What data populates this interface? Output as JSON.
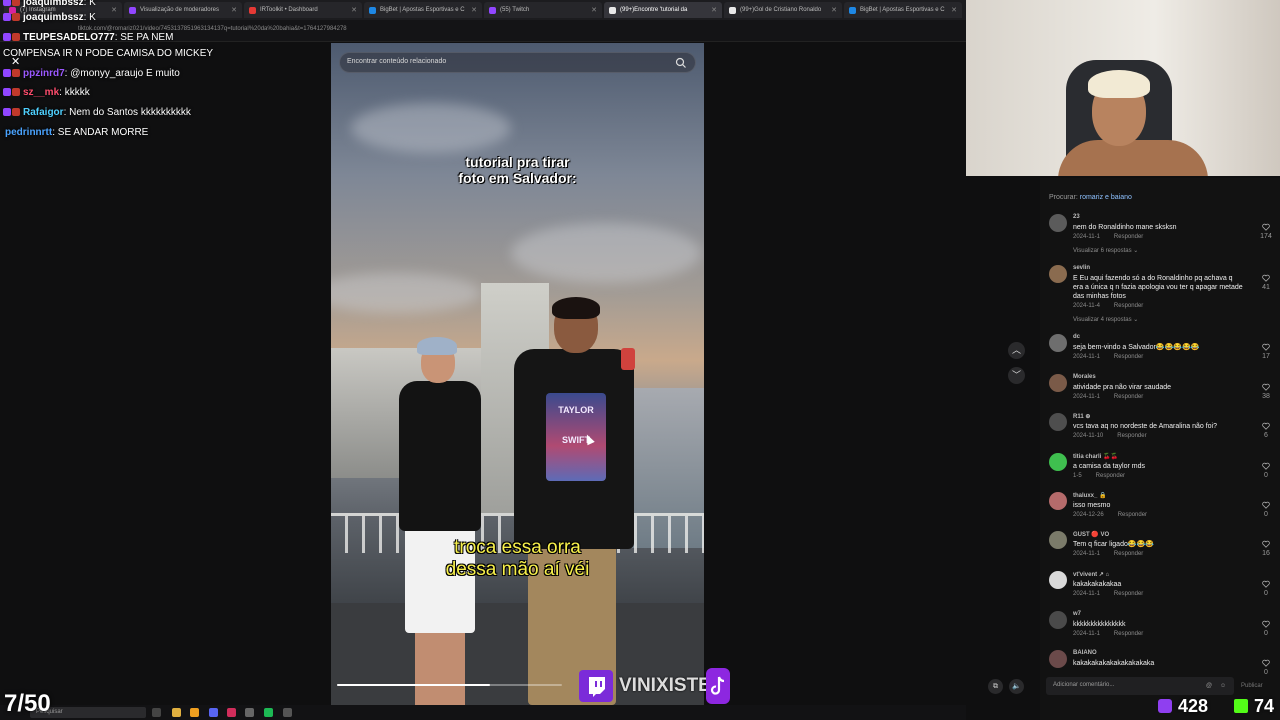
{
  "browser": {
    "tabs": [
      {
        "label": "(7) Instagram",
        "color": "#d6249f"
      },
      {
        "label": "Visualização de moderadores",
        "color": "#9146ff"
      },
      {
        "label": "IRToolkit • Dashboard",
        "color": "#e53935"
      },
      {
        "label": "BigBet | Apostas Esportivas e C",
        "color": "#1e88e5"
      },
      {
        "label": "(55) Twitch",
        "color": "#9146ff"
      },
      {
        "label": "(99+)Encontre 'tutorial da",
        "color": "#e8e8e8"
      },
      {
        "label": "(99+)Gol de Cristiano Ronaldo",
        "color": "#e8e8e8"
      },
      {
        "label": "BigBet | Apostas Esportivas e C",
        "color": "#1e88e5"
      }
    ],
    "url": "tiktok.com/@romariz021/video/7453137851963134137q=tutorial%20da%20bahia&t=1764127984278"
  },
  "chat": {
    "messages": [
      {
        "user": "joaquimbssz",
        "text": ": K",
        "user_color": "#ffffff"
      },
      {
        "user": "joaquimbssz",
        "text": ": K",
        "user_color": "#ffffff"
      },
      {
        "user": "TEUPESADELO777",
        "text": ": SE PA NEM",
        "user_color": "#ffffff"
      },
      {
        "user": "",
        "text": "COMPENSA IR N PODE CAMISA DO MICKEY",
        "user_color": "#ffffff"
      },
      {
        "user": "ppzinrd7",
        "text": ": @monyy_araujo E muito",
        "user_color": "#9b59ff"
      },
      {
        "user": "sz__mk",
        "text": ": kkkkk",
        "user_color": "#ff4d6d"
      },
      {
        "user": "Rafaigor",
        "text": ": Nem do Santos kkkkkkkkkk",
        "user_color": "#4fd1ff"
      },
      {
        "user": "pedrinnrtt",
        "text": ": SE ANDAR MORRE",
        "user_color": "#4aa3ff"
      }
    ]
  },
  "video": {
    "search_placeholder": "Encontrar conteúdo relacionado",
    "caption_top_line1": "tutorial pra tirar",
    "caption_top_line2": "foto em Salvador:",
    "caption_bottom_line1": "troca essa orra",
    "caption_bottom_line2": "dessa mão aí véi",
    "shirt_line1": "TAYLOR",
    "shirt_line2": "SWIFT",
    "progress_fraction": 0.68
  },
  "watermark": {
    "text": "VINIXISTE"
  },
  "comments_panel": {
    "search_label": "Procurar:",
    "search_query": "romariz e baiano",
    "comments": [
      {
        "user": "23",
        "text": "nem do Ronaldinho mane sksksn",
        "date": "2024-11-1",
        "reply": "Responder",
        "likes": "174",
        "more": "Visualizar 6 respostas ⌄",
        "avatar": "#5b5b5b"
      },
      {
        "user": "sevlin",
        "text": "E Eu aqui fazendo só a do Ronaldinho pq achava q era a única q n fazia apologia vou ter q apagar metade das minhas fotos",
        "date": "2024-11-4",
        "reply": "Responder",
        "likes": "41",
        "more": "Visualizar 4 respostas ⌄",
        "avatar": "#8a6b4f"
      },
      {
        "user": "dc",
        "text": "seja bem-vindo a Salvador😂😂😂😂😂",
        "date": "2024-11-1",
        "reply": "Responder",
        "likes": "17",
        "more": "",
        "avatar": "#6e6e6e"
      },
      {
        "user": "Morales",
        "text": "atividade pra não virar saudade",
        "date": "2024-11-1",
        "reply": "Responder",
        "likes": "38",
        "more": "",
        "avatar": "#7a5a48"
      },
      {
        "user": "R11 ⊕",
        "text": "vcs tava aq no nordeste de Amaralina não foi?",
        "date": "2024-11-10",
        "reply": "Responder",
        "likes": "6",
        "more": "",
        "avatar": "#4e4e4e"
      },
      {
        "user": "titia charli 🍒🍒",
        "text": "a camisa da taylor mds",
        "date": "1-5",
        "reply": "Responder",
        "likes": "0",
        "more": "",
        "avatar": "#3fbf4f"
      },
      {
        "user": "thaluxx_ 🔒",
        "text": "isso mesmo",
        "date": "2024-12-26",
        "reply": "Responder",
        "likes": "0",
        "more": "",
        "avatar": "#b56b6b"
      },
      {
        "user": "GUST 🔴 VO",
        "text": "Tem q ficar ligado😂😂😂",
        "date": "2024-11-1",
        "reply": "Responder",
        "likes": "16",
        "more": "",
        "avatar": "#7b7b6a"
      },
      {
        "user": "vt'vivent ↗ ⌂",
        "text": "kakakakakakaa",
        "date": "2024-11-1",
        "reply": "Responder",
        "likes": "0",
        "more": "",
        "avatar": "#d9d9d9"
      },
      {
        "user": "w7",
        "text": "kkkkkkkkkkkkkkk",
        "date": "2024-11-1",
        "reply": "Responder",
        "likes": "0",
        "more": "",
        "avatar": "#4a4a4a"
      },
      {
        "user": "BAIANO",
        "text": "kakakakakakakakakakaka",
        "date": "",
        "reply": "",
        "likes": "0",
        "more": "",
        "avatar": "#6b4a4a"
      }
    ],
    "input_placeholder": "Adicionar comentário...",
    "post_label": "Publicar"
  },
  "overlay": {
    "counter": "7/50",
    "viewers_twitch": "428",
    "viewers_kick": "74",
    "taskbar_search": "Pesquisar"
  }
}
